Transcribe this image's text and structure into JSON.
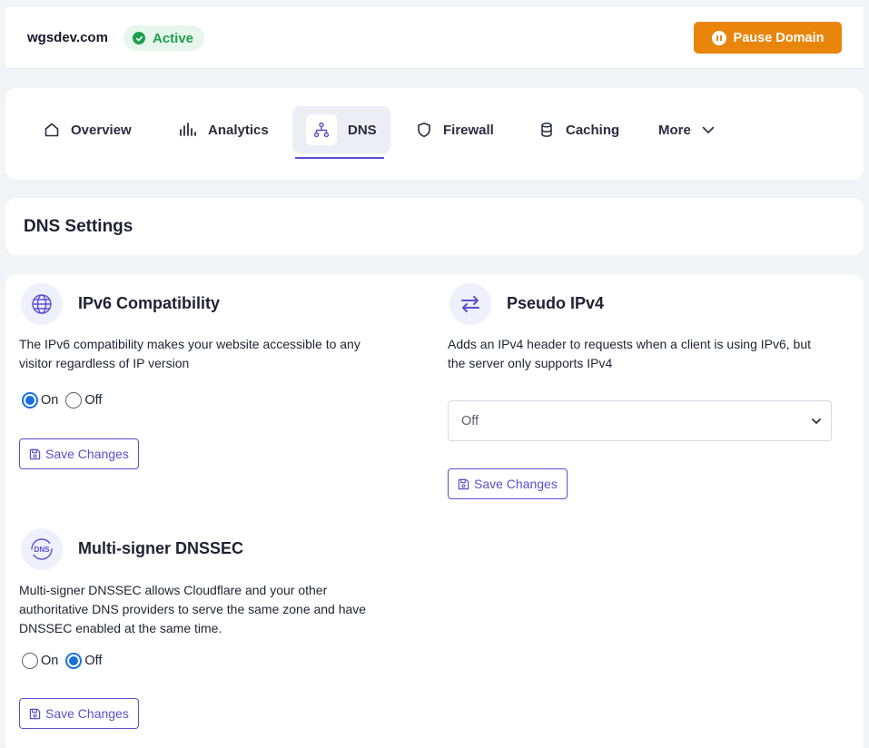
{
  "header": {
    "domain": "wgsdev.com",
    "status": "Active",
    "pause_label": "Pause Domain"
  },
  "nav": {
    "tabs": [
      {
        "label": "Overview",
        "icon": "home-icon"
      },
      {
        "label": "Analytics",
        "icon": "bar-chart-icon"
      },
      {
        "label": "DNS",
        "icon": "network-icon",
        "active": true
      },
      {
        "label": "Firewall",
        "icon": "shield-icon"
      },
      {
        "label": "Caching",
        "icon": "database-icon"
      },
      {
        "label": "More",
        "icon": "chevron-down-icon"
      }
    ]
  },
  "page": {
    "title": "DNS Settings"
  },
  "ipv6": {
    "title": "IPv6 Compatibility",
    "desc_line1": "The IPv6 compatibility makes your website accessible to any",
    "desc_line2": "visitor regardless of IP version",
    "on_label": "On",
    "off_label": "Off",
    "selected": "On",
    "save_label": "Save Changes"
  },
  "pseudo_ipv4": {
    "title": "Pseudo IPv4",
    "desc_line1": "Adds an IPv4 header to requests when a client is using IPv6, but",
    "desc_line2": "the server only supports IPv4",
    "select_value": "Off",
    "save_label": "Save Changes"
  },
  "dnssec": {
    "title": "Multi-signer DNSSEC",
    "desc_line1": "Multi-signer DNSSEC allows Cloudflare and your other",
    "desc_line2": "authoritative DNS providers to serve the same zone and have",
    "desc_line3": "DNSSEC enabled at the same time.",
    "on_label": "On",
    "off_label": "Off",
    "selected": "Off",
    "save_label": "Save Changes",
    "icon_text": "DNS"
  },
  "colors": {
    "accent": "#5a4fcf",
    "pause": "#e8850a",
    "active_green": "#1e9e4e",
    "radio_blue": "#1a6fe0"
  }
}
